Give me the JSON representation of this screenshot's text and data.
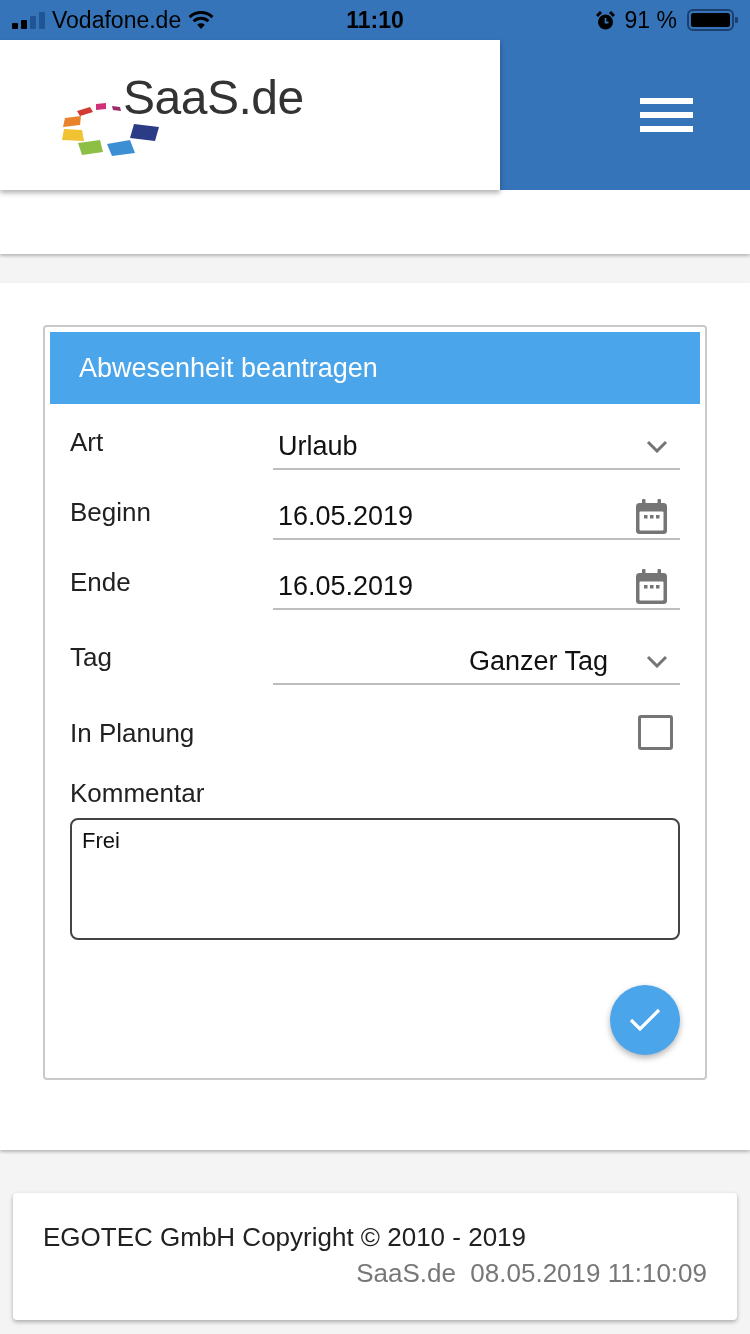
{
  "status_bar": {
    "carrier": "Vodafone.de",
    "time": "11:10",
    "battery": "91 %"
  },
  "header": {
    "logo_text": "SaaS.de"
  },
  "form": {
    "title": "Abwesenheit beantragen",
    "fields": [
      {
        "kind": "select",
        "label": "Art",
        "value": "Urlaub"
      },
      {
        "kind": "date",
        "label": "Beginn",
        "value": "16.05.2019"
      },
      {
        "kind": "date",
        "label": "Ende",
        "value": "16.05.2019"
      },
      {
        "kind": "picker",
        "label": "Tag",
        "value": "Ganzer Tag"
      },
      {
        "kind": "checkbox",
        "label": "In Planung",
        "checked": false
      },
      {
        "kind": "textarea",
        "label": "Kommentar",
        "value": "Frei"
      }
    ]
  },
  "footer": {
    "copyright": "EGOTEC GmbH Copyright © 2010 - 2019",
    "info": "SaaS.de  08.05.2019 11:10:09"
  }
}
